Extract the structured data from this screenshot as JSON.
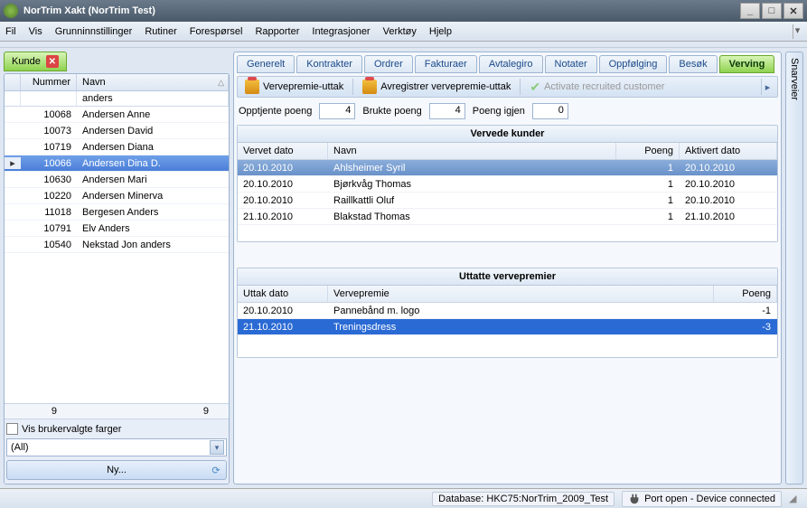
{
  "titlebar": {
    "title": "NorTrim Xakt (NorTrim Test)"
  },
  "menu": [
    "Fil",
    "Vis",
    "Grunninnstillinger",
    "Rutiner",
    "Forespørsel",
    "Rapporter",
    "Integrasjoner",
    "Verktøy",
    "Hjelp"
  ],
  "kundeTab": {
    "label": "Kunde"
  },
  "leftGrid": {
    "headers": {
      "nummer": "Nummer",
      "navn": "Navn"
    },
    "filter": {
      "navn": "anders"
    },
    "rows": [
      {
        "nummer": "10068",
        "navn": "Andersen Anne",
        "selected": false
      },
      {
        "nummer": "10073",
        "navn": "Andersen David",
        "selected": false
      },
      {
        "nummer": "10719",
        "navn": "Andersen Diana",
        "selected": false
      },
      {
        "nummer": "10066",
        "navn": "Andersen Dina D.",
        "selected": true
      },
      {
        "nummer": "10630",
        "navn": "Andersen Mari",
        "selected": false
      },
      {
        "nummer": "10220",
        "navn": "Andersen Minerva",
        "selected": false
      },
      {
        "nummer": "11018",
        "navn": "Bergesen Anders",
        "selected": false
      },
      {
        "nummer": "10791",
        "navn": "Elv Anders",
        "selected": false
      },
      {
        "nummer": "10540",
        "navn": "Nekstad Jon anders",
        "selected": false
      }
    ],
    "footer": {
      "nummer": "9",
      "navn": "9"
    },
    "visBrukervalgte": "Vis brukervalgte farger",
    "filterAll": "(All)",
    "nyBtn": "Ny..."
  },
  "tabs": [
    "Generelt",
    "Kontrakter",
    "Ordrer",
    "Fakturaer",
    "Avtalegiro",
    "Notater",
    "Oppfølging",
    "Besøk",
    "Verving"
  ],
  "activeTab": "Verving",
  "toolbar": {
    "vervepremieUttak": "Vervepremie-uttak",
    "avregistrer": "Avregistrer vervepremie-uttak",
    "activate": "Activate recruited customer"
  },
  "points": {
    "opptjenteLabel": "Opptjente poeng",
    "opptjente": "4",
    "brukteLabel": "Brukte poeng",
    "brukte": "4",
    "igjenLabel": "Poeng igjen",
    "igjen": "0"
  },
  "vervede": {
    "title": "Vervede kunder",
    "headers": {
      "dato": "Vervet dato",
      "navn": "Navn",
      "poeng": "Poeng",
      "aktivert": "Aktivert dato"
    },
    "rows": [
      {
        "dato": "20.10.2010",
        "navn": "Ahlsheimer Syril",
        "poeng": "1",
        "aktivert": "20.10.2010",
        "selected": true
      },
      {
        "dato": "20.10.2010",
        "navn": "Bjørkvåg Thomas",
        "poeng": "1",
        "aktivert": "20.10.2010",
        "selected": false
      },
      {
        "dato": "20.10.2010",
        "navn": "Raillkattli Oluf",
        "poeng": "1",
        "aktivert": "20.10.2010",
        "selected": false
      },
      {
        "dato": "21.10.2010",
        "navn": "Blakstad Thomas",
        "poeng": "1",
        "aktivert": "21.10.2010",
        "selected": false
      }
    ]
  },
  "uttatte": {
    "title": "Uttatte vervepremier",
    "headers": {
      "dato": "Uttak dato",
      "premie": "Vervepremie",
      "poeng": "Poeng"
    },
    "rows": [
      {
        "dato": "20.10.2010",
        "premie": "Pannebånd m. logo",
        "poeng": "-1",
        "selected": false
      },
      {
        "dato": "21.10.2010",
        "premie": "Treningsdress",
        "poeng": "-3",
        "selected": true
      }
    ]
  },
  "snarveier": "Snarveier",
  "status": {
    "db": "Database: HKC75:NorTrim_2009_Test",
    "port": "Port open - Device connected"
  }
}
